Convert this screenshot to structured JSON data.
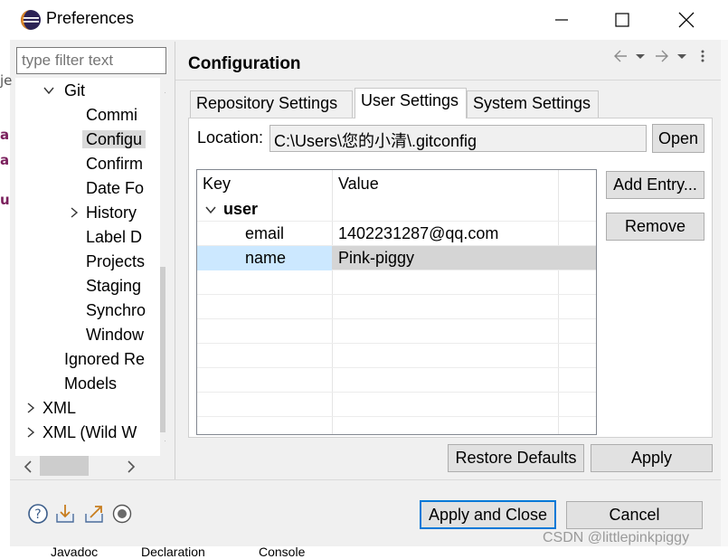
{
  "window": {
    "title": "Preferences",
    "icon": "eclipse-icon",
    "controls": [
      "minimize-icon",
      "maximize-icon",
      "close-icon"
    ]
  },
  "background_app": {
    "marks": [
      "je",
      "a",
      "a",
      "u"
    ]
  },
  "sidebar": {
    "filter_placeholder": "type filter text",
    "items": [
      {
        "label": "Git",
        "level": 1,
        "expander": "expanded"
      },
      {
        "label": "Commi",
        "level": 2
      },
      {
        "label": "Configu",
        "level": 2,
        "selected": true
      },
      {
        "label": "Confirm",
        "level": 2
      },
      {
        "label": "Date Fo",
        "level": 2
      },
      {
        "label": "History",
        "level": 2,
        "expander": "collapsed"
      },
      {
        "label": "Label D",
        "level": 2
      },
      {
        "label": "Projects",
        "level": 2
      },
      {
        "label": "Staging",
        "level": 2
      },
      {
        "label": "Synchro",
        "level": 2
      },
      {
        "label": "Window",
        "level": 2
      },
      {
        "label": "Ignored Re",
        "level": 1
      },
      {
        "label": "Models",
        "level": 1
      },
      {
        "label": "XML",
        "level": 0,
        "expander": "collapsed"
      },
      {
        "label": "XML (Wild W",
        "level": 0,
        "expander": "collapsed"
      }
    ]
  },
  "page": {
    "title": "Configuration",
    "nav_icons": [
      "back-arrow-icon",
      "back-menu-icon",
      "forward-arrow-icon",
      "forward-menu-icon",
      "more-options-icon"
    ]
  },
  "tabs": [
    {
      "label": "Repository Settings",
      "active": false
    },
    {
      "label": "User Settings",
      "active": true
    },
    {
      "label": "System Settings",
      "active": false
    }
  ],
  "location": {
    "label": "Location:",
    "value": "C:\\Users\\您的小清\\.gitconfig",
    "open_button": "Open"
  },
  "table": {
    "columns": [
      "Key",
      "Value"
    ],
    "rows": [
      {
        "key": "user",
        "value": "",
        "group": true
      },
      {
        "key": "email",
        "value": "1402231287@qq.com"
      },
      {
        "key": "name",
        "value": "Pink-piggy",
        "selected": true
      }
    ]
  },
  "side_buttons": {
    "add_entry": "Add Entry...",
    "remove": "Remove"
  },
  "page_buttons": {
    "restore_defaults": "Restore Defaults",
    "apply": "Apply"
  },
  "dialog_buttons": {
    "apply_and_close": "Apply and Close",
    "cancel": "Cancel"
  },
  "footer_icons": [
    "help-icon",
    "import-icon",
    "export-icon",
    "record-icon"
  ],
  "watermark": "CSDN @littlepinkpiggy",
  "taskbar": [
    "Javadoc",
    "Declaration",
    "Console"
  ]
}
